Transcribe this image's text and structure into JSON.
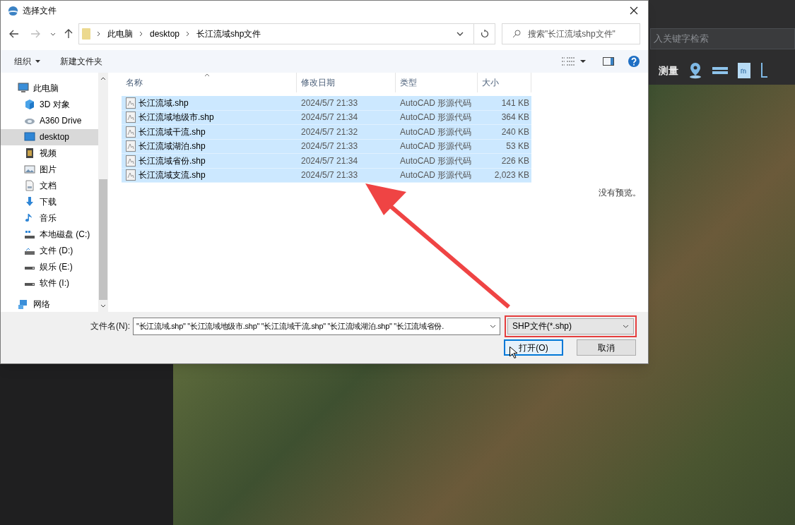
{
  "app": {
    "search": {
      "placeholder": "入关键字检索"
    },
    "toolbar_label": "测量"
  },
  "dialog": {
    "title": "选择文件",
    "breadcrumbs": [
      "此电脑",
      "desktop",
      "长江流域shp文件"
    ],
    "search": {
      "placeholder": "搜索\"长江流域shp文件\""
    },
    "toolbar": {
      "organize": "组织",
      "new_folder": "新建文件夹"
    },
    "sidebar": {
      "items": [
        {
          "label": "此电脑",
          "kind": "pc",
          "selected": false,
          "children": [
            {
              "label": "3D 对象",
              "kind": "cube",
              "selected": false
            },
            {
              "label": "A360 Drive",
              "kind": "cloud",
              "selected": false
            },
            {
              "label": "desktop",
              "kind": "desktop",
              "selected": true
            },
            {
              "label": "视频",
              "kind": "video",
              "selected": false
            },
            {
              "label": "图片",
              "kind": "picture",
              "selected": false
            },
            {
              "label": "文档",
              "kind": "document",
              "selected": false
            },
            {
              "label": "下载",
              "kind": "download",
              "selected": false
            },
            {
              "label": "音乐",
              "kind": "music",
              "selected": false
            },
            {
              "label": "本地磁盘 (C:)",
              "kind": "systemdrive",
              "selected": false
            },
            {
              "label": "文件 (D:)",
              "kind": "netdrive",
              "selected": false
            },
            {
              "label": "娱乐 (E:)",
              "kind": "drive",
              "selected": false
            },
            {
              "label": "软件 (I:)",
              "kind": "drive",
              "selected": false
            }
          ]
        },
        {
          "label": "网络",
          "kind": "network",
          "selected": false
        }
      ]
    },
    "columns": [
      "名称",
      "修改日期",
      "类型",
      "大小"
    ],
    "files": [
      {
        "name": "长江流域.shp",
        "date": "2024/5/7 21:33",
        "type": "AutoCAD 形源代码",
        "size": "141 KB",
        "selected": true
      },
      {
        "name": "长江流域地级市.shp",
        "date": "2024/5/7 21:34",
        "type": "AutoCAD 形源代码",
        "size": "364 KB",
        "selected": true
      },
      {
        "name": "长江流域干流.shp",
        "date": "2024/5/7 21:32",
        "type": "AutoCAD 形源代码",
        "size": "240 KB",
        "selected": true
      },
      {
        "name": "长江流域湖泊.shp",
        "date": "2024/5/7 21:33",
        "type": "AutoCAD 形源代码",
        "size": "53 KB",
        "selected": true
      },
      {
        "name": "长江流域省份.shp",
        "date": "2024/5/7 21:34",
        "type": "AutoCAD 形源代码",
        "size": "226 KB",
        "selected": true
      },
      {
        "name": "长江流域支流.shp",
        "date": "2024/5/7 21:33",
        "type": "AutoCAD 形源代码",
        "size": "2,023 KB",
        "selected": true
      }
    ],
    "preview": "没有预览。",
    "file_name": {
      "label": "文件名(N):",
      "value": "\"长江流域.shp\" \"长江流域地级市.shp\" \"长江流域干流.shp\" \"长江流域湖泊.shp\" \"长江流域省份."
    },
    "file_type": "SHP文件(*.shp)",
    "buttons": [
      "打开(O)",
      "取消"
    ]
  }
}
